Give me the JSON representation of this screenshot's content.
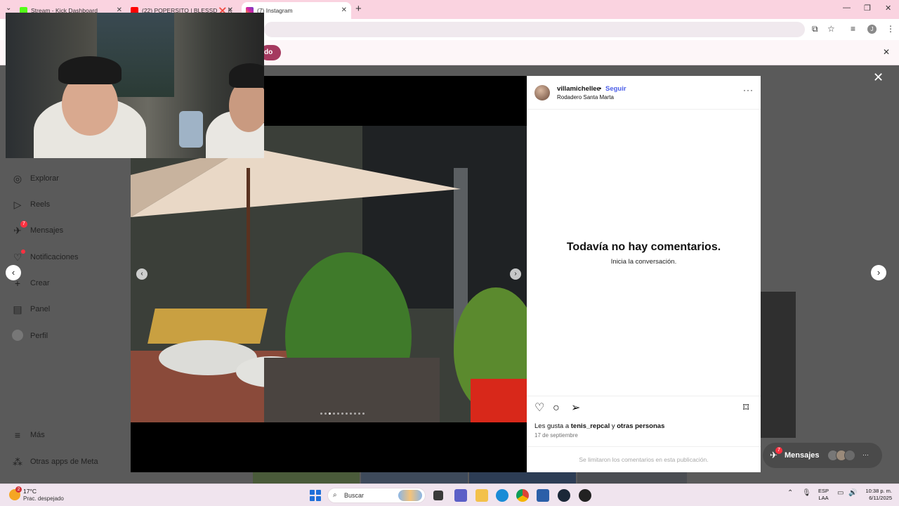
{
  "browser": {
    "tabs": [
      {
        "title": "Stream - Kick Dashboard",
        "favicon_color": "#53fc18"
      },
      {
        "title": "(22) POPERSITO | BLESSD ❌ K",
        "favicon_color": "#ff0000"
      },
      {
        "title": "(7) Instagram",
        "favicon_color": "#d6249f"
      }
    ],
    "new_tab": "+",
    "infobar_button": "do"
  },
  "sidebar": {
    "items": [
      {
        "label": "Explorar",
        "icon": "compass-icon"
      },
      {
        "label": "Reels",
        "icon": "reels-icon"
      },
      {
        "label": "Mensajes",
        "icon": "messenger-icon",
        "badge": "7"
      },
      {
        "label": "Notificaciones",
        "icon": "heart-icon",
        "dot": true
      },
      {
        "label": "Crear",
        "icon": "plus-icon"
      },
      {
        "label": "Panel",
        "icon": "chart-icon"
      },
      {
        "label": "Perfil",
        "icon": "avatar"
      },
      {
        "label": "Más",
        "icon": "menu-icon"
      },
      {
        "label": "Otras apps de Meta",
        "icon": "meta-apps-icon"
      }
    ]
  },
  "post": {
    "username": "villamichellee",
    "separator": "•",
    "follow_label": "Seguir",
    "location": "Rodadero Santa Marta",
    "more": "···",
    "empty_title": "Todavía no hay comentarios.",
    "empty_sub": "Inicia la conversación.",
    "likes_prefix": "Les gusta a",
    "likes_user": "tenis_repcal",
    "likes_joiner": "y",
    "likes_others": "otras personas",
    "date": "17 de septiembre",
    "comments_limited": "Se limitaron los comentarios en esta publicación."
  },
  "messages_pill": {
    "label": "Mensajes",
    "badge": "7",
    "more": "···"
  },
  "taskbar": {
    "weather_badge": "2",
    "temperature": "17°C",
    "condition": "Prac. despejado",
    "search_label": "Buscar",
    "lang_line1": "ESP",
    "lang_line2": "LAA",
    "time": "10:38 p. m.",
    "date": "6/11/2025"
  },
  "colors": {
    "tabbar_bg": "#fad3e0",
    "follow_blue": "#4a5de8",
    "notification_red": "#ff3040",
    "infobar_button": "#a5395f"
  }
}
